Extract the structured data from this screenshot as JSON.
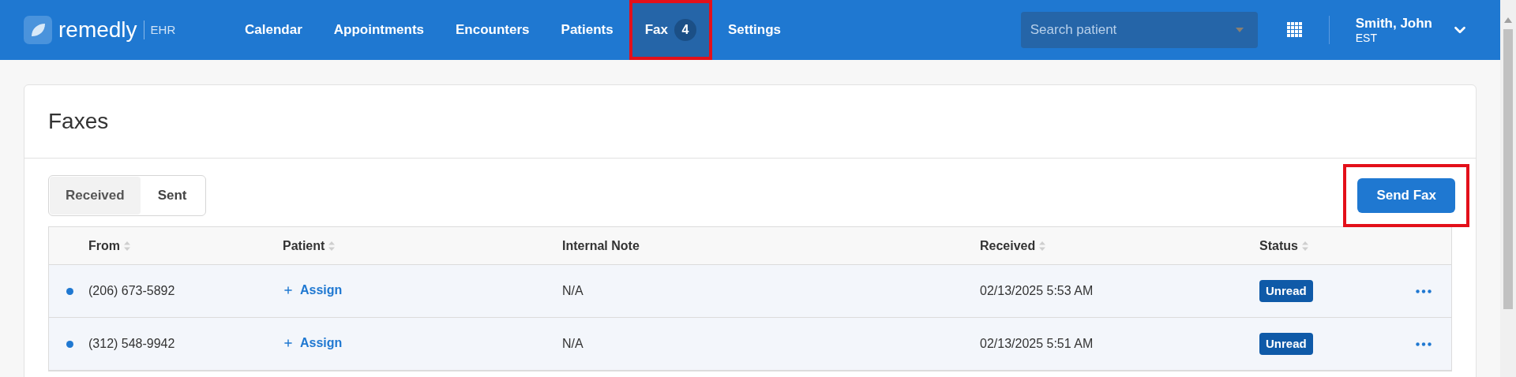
{
  "header": {
    "logo": {
      "name": "remedly",
      "product": "EHR"
    },
    "nav": [
      {
        "label": "Calendar",
        "selected": false,
        "highlighted": false
      },
      {
        "label": "Appointments",
        "selected": false,
        "highlighted": false
      },
      {
        "label": "Encounters",
        "selected": false,
        "highlighted": false
      },
      {
        "label": "Patients",
        "selected": false,
        "highlighted": false
      },
      {
        "label": "Fax",
        "badge": "4",
        "selected": true,
        "highlighted": true
      },
      {
        "label": "Settings",
        "selected": false,
        "highlighted": false
      }
    ],
    "search": {
      "placeholder": "Search patient"
    },
    "user": {
      "name": "Smith, John",
      "timezone": "EST"
    }
  },
  "page": {
    "title": "Faxes",
    "tabs": [
      {
        "label": "Received",
        "selected": true
      },
      {
        "label": "Sent",
        "selected": false
      }
    ],
    "send_button": {
      "label": "Send Fax",
      "highlighted": true
    },
    "table": {
      "columns": [
        {
          "label": "From",
          "sortable": true
        },
        {
          "label": "Patient",
          "sortable": true
        },
        {
          "label": "Internal Note",
          "sortable": false
        },
        {
          "label": "Received",
          "sortable": true
        },
        {
          "label": "Status",
          "sortable": true
        }
      ],
      "rows": [
        {
          "unread": true,
          "from": "(206) 673-5892",
          "patient": "Assign",
          "note": "N/A",
          "received": "02/13/2025 5:53 AM",
          "status": "Unread"
        },
        {
          "unread": true,
          "from": "(312) 548-9942",
          "patient": "Assign",
          "note": "N/A",
          "received": "02/13/2025 5:51 AM",
          "status": "Unread"
        }
      ]
    }
  }
}
